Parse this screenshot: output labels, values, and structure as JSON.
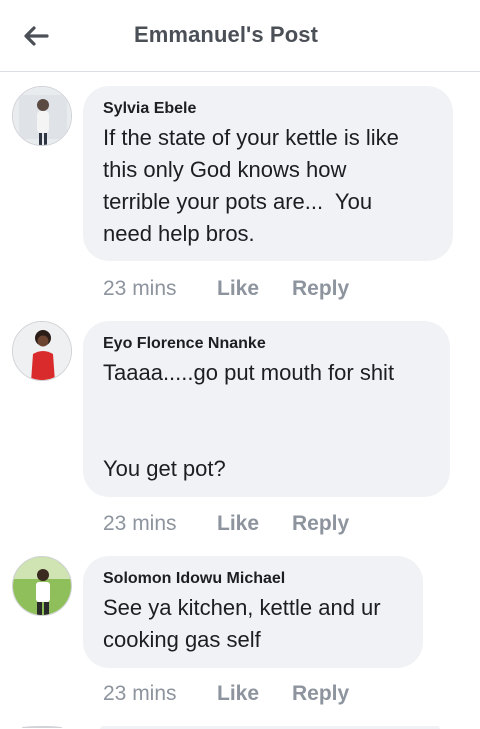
{
  "header": {
    "title": "Emmanuel's Post"
  },
  "comments": [
    {
      "author": "Sylvia Ebele",
      "text": "If the state of your kettle is like\nthis only God knows how\nterrible your pots are...  You\nneed help bros.",
      "time": "23 mins",
      "like_label": "Like",
      "reply_label": "Reply"
    },
    {
      "author": "Eyo Florence Nnanke",
      "text": "Taaaa.....go put mouth for shit\n\n\nYou get pot?",
      "time": "23 mins",
      "like_label": "Like",
      "reply_label": "Reply"
    },
    {
      "author": "Solomon Idowu Michael",
      "text": "See ya kitchen, kettle and ur\ncooking gas self",
      "time": "23 mins",
      "like_label": "Like",
      "reply_label": "Reply"
    }
  ],
  "colors": {
    "bubble": "#f0f2f5",
    "muted_text": "#8d949e",
    "title_text": "#4b4f56"
  }
}
